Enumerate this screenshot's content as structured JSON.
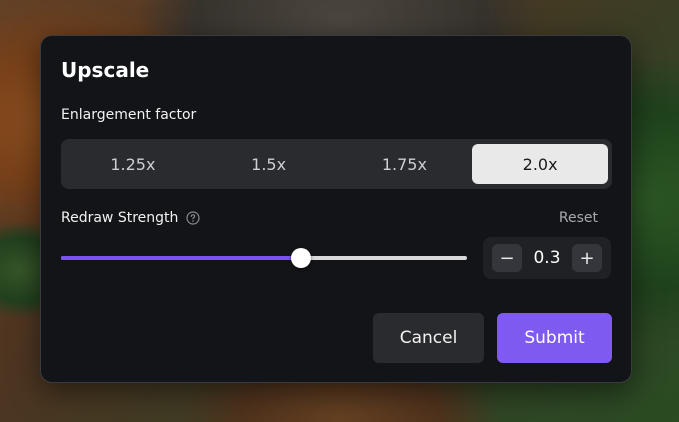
{
  "dialog": {
    "title": "Upscale",
    "enlargement": {
      "label": "Enlargement factor",
      "options": [
        "1.25x",
        "1.5x",
        "1.75x",
        "2.0x"
      ],
      "selected": "2.0x"
    },
    "redraw": {
      "label": "Redraw Strength",
      "help_icon": "question-circle-icon",
      "reset_label": "Reset",
      "value": "0.3",
      "slider_fraction": 0.59,
      "decrement_label": "−",
      "increment_label": "+"
    },
    "cancel_label": "Cancel",
    "submit_label": "Submit"
  },
  "colors": {
    "accent": "#7f5af0",
    "dialog_bg": "#131417",
    "selected_segment": "#e9e9ea"
  }
}
